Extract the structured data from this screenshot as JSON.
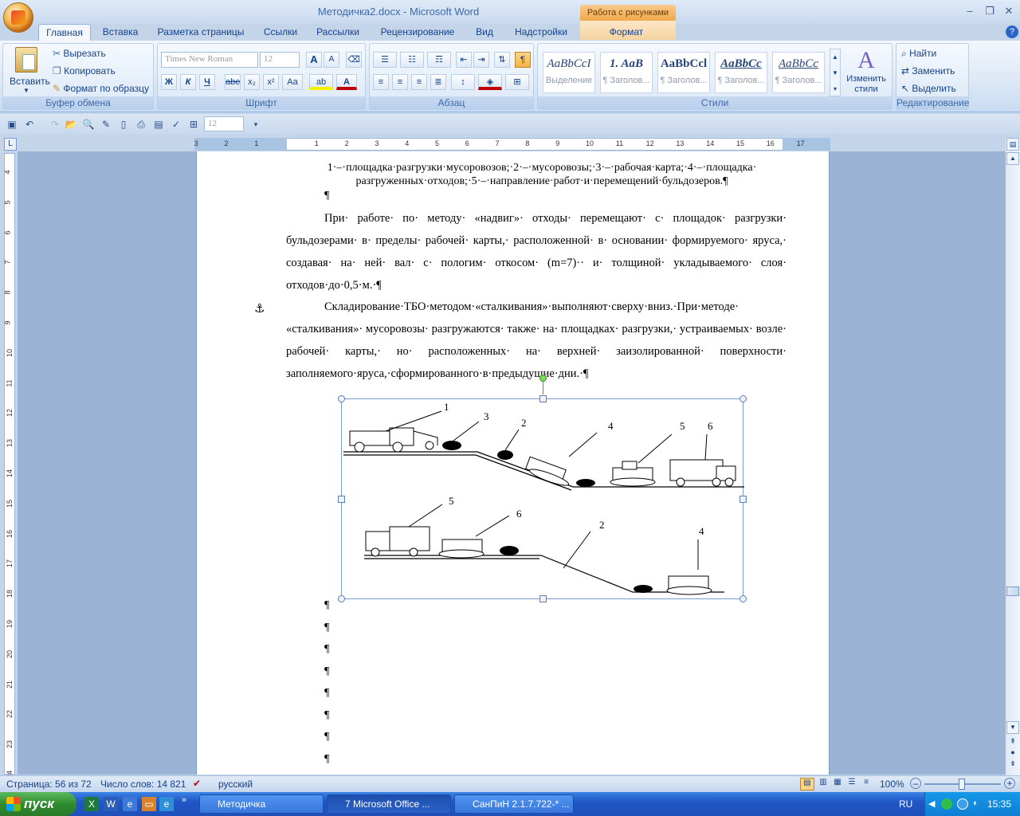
{
  "window": {
    "title": "Методичка2.docx - Microsoft Word",
    "context_tab": "Работа с рисунками"
  },
  "ribbon_tabs": [
    "Главная",
    "Вставка",
    "Разметка страницы",
    "Ссылки",
    "Рассылки",
    "Рецензирование",
    "Вид",
    "Надстройки",
    "Формат"
  ],
  "clipboard": {
    "paste": "Вставить",
    "cut": "Вырезать",
    "copy": "Копировать",
    "format_painter": "Формат по образцу",
    "label": "Буфер обмена"
  },
  "font": {
    "family": "Times New Roman",
    "size": "12",
    "bold": "Ж",
    "italic": "К",
    "underline": "Ч",
    "strike": "abe",
    "sub": "x₂",
    "sup": "x²",
    "case": "Aa",
    "grow": "A",
    "shrink": "A",
    "label": "Шрифт"
  },
  "paragraph": {
    "label": "Абзац",
    "show_marks": "¶"
  },
  "styles": {
    "items": [
      {
        "sample": "AaBbCcI",
        "name": "Выделение"
      },
      {
        "sample": "1. AaB",
        "name": "¶ Заголов..."
      },
      {
        "sample": "AaBbCcl",
        "name": "¶ Заголов..."
      },
      {
        "sample": "AaBbCc",
        "name": "¶ Заголов..."
      },
      {
        "sample": "AaBbCc",
        "name": "¶ Заголов..."
      }
    ],
    "change": "Изменить стили",
    "label": "Стили"
  },
  "editing": {
    "find": "Найти",
    "replace": "Заменить",
    "select": "Выделить",
    "label": "Редактирование"
  },
  "qat": {
    "font_size": "12"
  },
  "ruler": {
    "h_ticks": [
      "3",
      "2",
      "1",
      "1",
      "2",
      "3",
      "4",
      "5",
      "6",
      "7",
      "8",
      "9",
      "10",
      "11",
      "12",
      "13",
      "14",
      "15",
      "16",
      "17"
    ],
    "v_ticks": [
      "4",
      "5",
      "6",
      "7",
      "8",
      "9",
      "10",
      "11",
      "12",
      "13",
      "14",
      "15",
      "16",
      "17",
      "18",
      "19",
      "20",
      "21",
      "22",
      "23",
      "24"
    ]
  },
  "document": {
    "caption_line1": "1·–·площадка·разгрузки·мусоровозов;·2·–·мусоровозы;·3·–·рабочая·карта;·4·–·площадка·",
    "caption_line2": "разгруженных·отходов;·5·–·направление·работ·и·перемещений·бульдозеров.¶",
    "pilcrow": "¶",
    "para1": "При· работе· по· методу· «надвиг»· отходы· перемещают· с· площадок· разгрузки· бульдозерами· в· пределы· рабочей· карты,· расположенной· в· основании· формируемого· яруса,· создавая· на· ней· вал· с· пологим· откосом· (m=7)·· и· толщиной· укладываемого· слоя· отходов·до·0,5·м.·¶",
    "para2": "Складирование·ТБО·методом·«сталкивания»·выполняют·сверху·вниз.·При·методе· «сталкивания»· мусоровозы· разгружаются· также· на· площадках· разгрузки,· устраиваемых· возле· рабочей· карты,· но· расположенных· на· верхней· заизолированной· поверхности· заполняемого·яруса,·сформированного·в·предыдущие·дни.·¶",
    "figure_labels_top": [
      "1",
      "3",
      "2",
      "4",
      "5",
      "6"
    ],
    "figure_labels_bottom": [
      "5",
      "6",
      "2",
      "4"
    ]
  },
  "status": {
    "page": "Страница: 56 из 72",
    "words": "Число слов: 14 821",
    "language": "русский",
    "zoom": "100%"
  },
  "taskbar": {
    "start": "пуск",
    "buttons": [
      "Методичка",
      "7 Microsoft Office ...",
      "СанПиН 2.1.7.722-* ..."
    ],
    "lang": "RU",
    "clock": "15:35"
  }
}
